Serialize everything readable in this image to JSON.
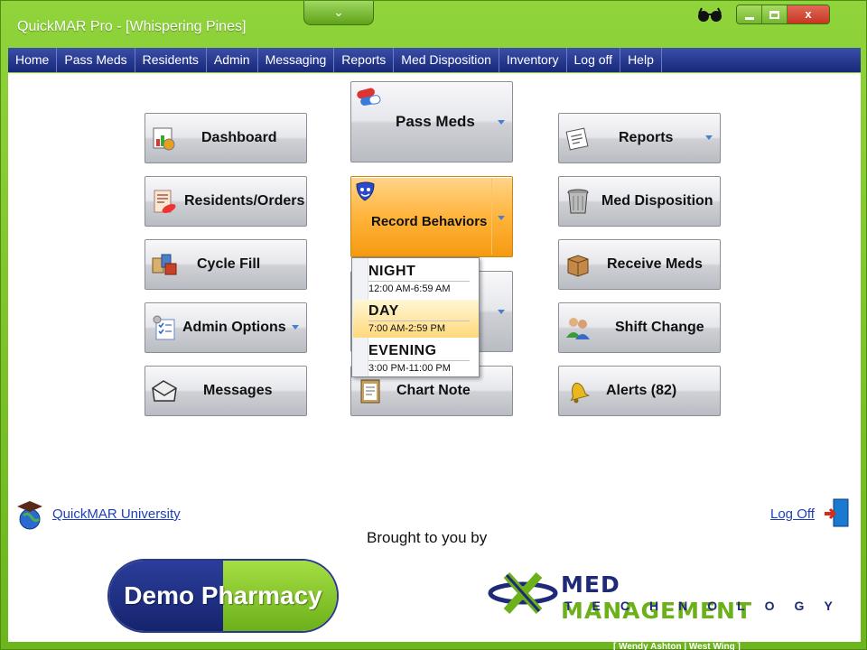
{
  "window": {
    "title": "QuickMAR Pro - [Whispering Pines]",
    "tab_glyph": "⌄",
    "close_glyph": "x"
  },
  "menu": [
    {
      "label": "Home"
    },
    {
      "label": "Pass Meds"
    },
    {
      "label": "Residents"
    },
    {
      "label": "Admin"
    },
    {
      "label": "Messaging"
    },
    {
      "label": "Reports"
    },
    {
      "label": "Med Disposition"
    },
    {
      "label": "Inventory"
    },
    {
      "label": "Log off"
    },
    {
      "label": "Help"
    }
  ],
  "buttons": {
    "dashboard": "Dashboard",
    "residents_orders": "Residents/Orders",
    "cycle_fill": "Cycle Fill",
    "admin_options": "Admin Options",
    "messages": "Messages",
    "pass_meds": "Pass Meds",
    "record_behaviors": "Record Behaviors",
    "chart_note": "Chart Note",
    "reports": "Reports",
    "med_disposition": "Med Disposition",
    "receive_meds": "Receive Meds",
    "shift_change": "Shift Change",
    "alerts": "Alerts (82)"
  },
  "shift_menu": [
    {
      "name": "NIGHT",
      "time": "12:00 AM-6:59 AM",
      "highlighted": false
    },
    {
      "name": "DAY",
      "time": "7:00 AM-2:59 PM",
      "highlighted": true
    },
    {
      "name": "EVENING",
      "time": "3:00 PM-11:00 PM",
      "highlighted": false
    }
  ],
  "footer": {
    "university_link": "QuickMAR University",
    "logoff_link": "Log Off",
    "brought_by": "Brought to you by",
    "pharmacy_logo": "Demo Pharmacy",
    "mmt_name_a": "MED ",
    "mmt_name_b": "MANAGEMENT",
    "mmt_tech": "TECHNOLOGY"
  },
  "status": {
    "user": "[ Wendy Ashton | West Wing ]"
  },
  "colors": {
    "frame_green": "#7cc224",
    "menu_blue": "#1f2f86",
    "highlight_orange": "#f5a623"
  }
}
